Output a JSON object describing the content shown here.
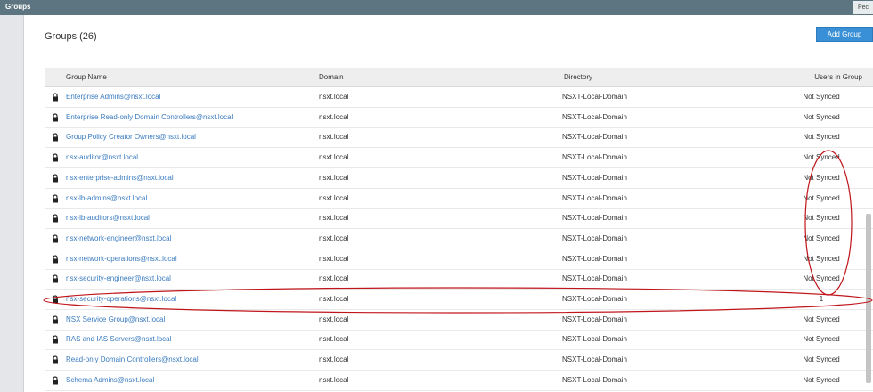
{
  "topbar": {
    "tab_label": "Groups",
    "right_label": "Pec"
  },
  "page": {
    "title": "Groups (26)",
    "add_button": "Add Group"
  },
  "table": {
    "columns": [
      "Group Name",
      "Domain",
      "Directory",
      "Users in Group"
    ],
    "rows": [
      {
        "name": "Enterprise Admins@nsxt.local",
        "domain": "nsxt.local",
        "directory": "NSXT-Local-Domain",
        "users": "Not Synced"
      },
      {
        "name": "Enterprise Read-only Domain Controllers@nsxt.local",
        "domain": "nsxt.local",
        "directory": "NSXT-Local-Domain",
        "users": "Not Synced"
      },
      {
        "name": "Group Policy Creator Owners@nsxt.local",
        "domain": "nsxt.local",
        "directory": "NSXT-Local-Domain",
        "users": "Not Synced"
      },
      {
        "name": "nsx-auditor@nsxt.local",
        "domain": "nsxt.local",
        "directory": "NSXT-Local-Domain",
        "users": "Not Synced"
      },
      {
        "name": "nsx-enterprise-admins@nsxt.local",
        "domain": "nsxt.local",
        "directory": "NSXT-Local-Domain",
        "users": "Not Synced"
      },
      {
        "name": "nsx-lb-admins@nsxt.local",
        "domain": "nsxt.local",
        "directory": "NSXT-Local-Domain",
        "users": "Not Synced"
      },
      {
        "name": "nsx-lb-auditors@nsxt.local",
        "domain": "nsxt.local",
        "directory": "NSXT-Local-Domain",
        "users": "Not Synced"
      },
      {
        "name": "nsx-network-engineer@nsxt.local",
        "domain": "nsxt.local",
        "directory": "NSXT-Local-Domain",
        "users": "Not Synced"
      },
      {
        "name": "nsx-network-operations@nsxt.local",
        "domain": "nsxt.local",
        "directory": "NSXT-Local-Domain",
        "users": "Not Synced"
      },
      {
        "name": "nsx-security-engineer@nsxt.local",
        "domain": "nsxt.local",
        "directory": "NSXT-Local-Domain",
        "users": "Not Synced"
      },
      {
        "name": "nsx-security-operations@nsxt.local",
        "domain": "nsxt.local",
        "directory": "NSXT-Local-Domain",
        "users": "1"
      },
      {
        "name": "NSX Service Group@nsxt.local",
        "domain": "nsxt.local",
        "directory": "NSXT-Local-Domain",
        "users": "Not Synced"
      },
      {
        "name": "RAS and IAS Servers@nsxt.local",
        "domain": "nsxt.local",
        "directory": "NSXT-Local-Domain",
        "users": "Not Synced"
      },
      {
        "name": "Read-only Domain Controllers@nsxt.local",
        "domain": "nsxt.local",
        "directory": "NSXT-Local-Domain",
        "users": "Not Synced"
      },
      {
        "name": "Schema Admins@nsxt.local",
        "domain": "nsxt.local",
        "directory": "NSXT-Local-Domain",
        "users": "Not Synced"
      }
    ]
  },
  "icons": {
    "row_icon": "lock-icon"
  },
  "colors": {
    "topbar": "#5d7580",
    "link": "#3a7bbf",
    "button": "#3a90d6",
    "annotation": "#c0151b"
  }
}
